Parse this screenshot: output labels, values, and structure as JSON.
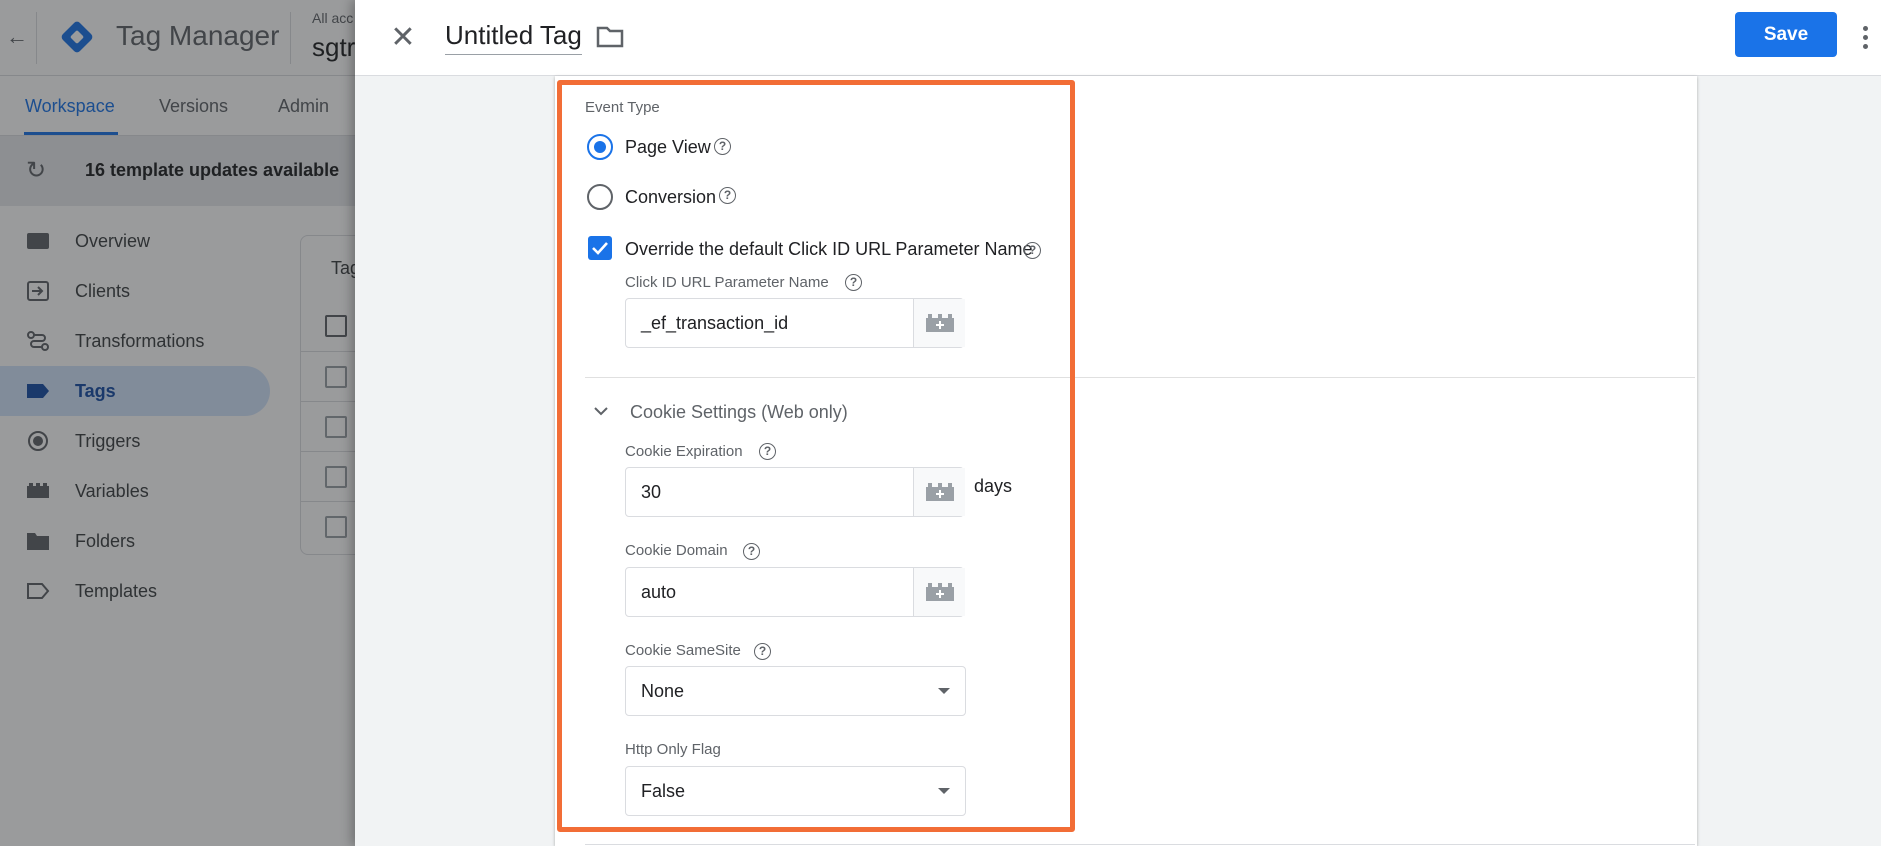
{
  "background": {
    "app_name": "Tag Manager",
    "account_label": "All acc",
    "container_name": "sgtr",
    "tabs": [
      {
        "label": "Workspace",
        "active": true
      },
      {
        "label": "Versions",
        "active": false
      },
      {
        "label": "Admin",
        "active": false
      }
    ],
    "banner": "16 template updates available",
    "nav": [
      {
        "label": "Overview",
        "icon": "overview-icon",
        "active": false
      },
      {
        "label": "Clients",
        "icon": "clients-icon",
        "active": false
      },
      {
        "label": "Transformations",
        "icon": "transformations-icon",
        "active": false
      },
      {
        "label": "Tags",
        "icon": "tags-icon",
        "active": true
      },
      {
        "label": "Triggers",
        "icon": "triggers-icon",
        "active": false
      },
      {
        "label": "Variables",
        "icon": "variables-icon",
        "active": false
      },
      {
        "label": "Folders",
        "icon": "folder-icon",
        "active": false
      },
      {
        "label": "Templates",
        "icon": "templates-icon",
        "active": false
      }
    ],
    "card_title": "Tag"
  },
  "editor": {
    "title": "Untitled Tag",
    "save_label": "Save"
  },
  "form": {
    "event_type_label": "Event Type",
    "event_types": [
      {
        "label": "Page View",
        "selected": true
      },
      {
        "label": "Conversion",
        "selected": false
      }
    ],
    "override_label": "Override the default Click ID URL Parameter Name",
    "override_checked": true,
    "click_id_label": "Click ID URL Parameter Name",
    "click_id_value": "_ef_transaction_id",
    "cookie_section_title": "Cookie Settings (Web only)",
    "cookie_expiration_label": "Cookie Expiration",
    "cookie_expiration_value": "30",
    "cookie_expiration_suffix": "days",
    "cookie_domain_label": "Cookie Domain",
    "cookie_domain_value": "auto",
    "cookie_samesite_label": "Cookie SameSite",
    "cookie_samesite_value": "None",
    "http_only_label": "Http Only Flag",
    "http_only_value": "False"
  },
  "colors": {
    "accent": "#1a73e8",
    "highlight": "#f26d36"
  }
}
